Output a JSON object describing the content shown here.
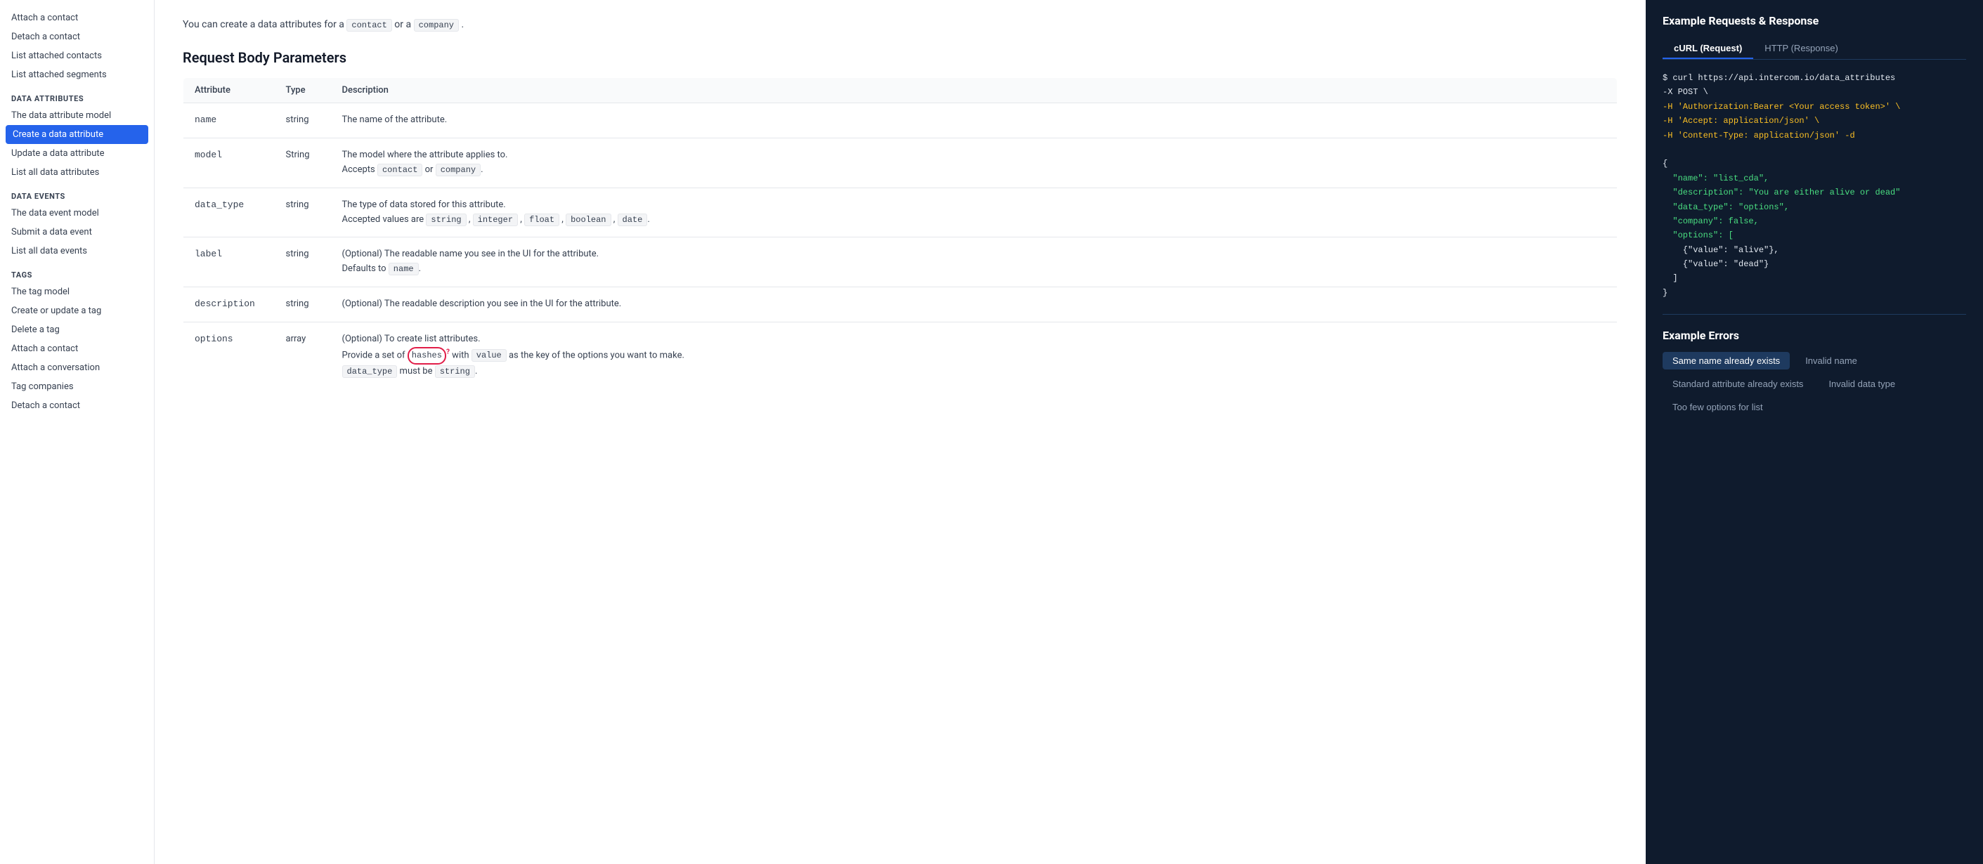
{
  "sidebar": {
    "items_top": [
      {
        "label": "Attach a contact",
        "active": false
      },
      {
        "label": "Detach a contact",
        "active": false
      },
      {
        "label": "List attached contacts",
        "active": false
      },
      {
        "label": "List attached segments",
        "active": false
      }
    ],
    "sections": [
      {
        "header": "DATA ATTRIBUTES",
        "items": [
          {
            "label": "The data attribute model",
            "active": false
          },
          {
            "label": "Create a data attribute",
            "active": true
          },
          {
            "label": "Update a data attribute",
            "active": false
          },
          {
            "label": "List all data attributes",
            "active": false
          }
        ]
      },
      {
        "header": "DATA EVENTS",
        "items": [
          {
            "label": "The data event model",
            "active": false
          },
          {
            "label": "Submit a data event",
            "active": false
          },
          {
            "label": "List all data events",
            "active": false
          }
        ]
      },
      {
        "header": "TAGS",
        "items": [
          {
            "label": "The tag model",
            "active": false
          },
          {
            "label": "Create or update a tag",
            "active": false
          },
          {
            "label": "Delete a tag",
            "active": false
          },
          {
            "label": "Attach a contact",
            "active": false
          },
          {
            "label": "Attach a conversation",
            "active": false
          },
          {
            "label": "Tag companies",
            "active": false
          },
          {
            "label": "Detach a contact",
            "active": false
          }
        ]
      }
    ]
  },
  "main": {
    "intro": "You can create a data attributes for a",
    "intro_code1": "contact",
    "intro_mid": "or a",
    "intro_code2": "company",
    "section_title": "Request Body Parameters",
    "table_headers": [
      "Attribute",
      "Type",
      "Description"
    ],
    "table_rows": [
      {
        "attr": "name",
        "type": "string",
        "desc": "The name of the attribute."
      },
      {
        "attr": "model",
        "type": "String",
        "desc_line1": "The model where the attribute applies to.",
        "desc_line2": "Accepts",
        "desc_code1": "contact",
        "desc_mid": "or",
        "desc_code2": "company",
        "desc_end": "."
      },
      {
        "attr": "data_type",
        "type": "string",
        "desc_line1": "The type of data stored for this attribute.",
        "desc_line2": "Accepted values are",
        "codes": [
          "string",
          "integer",
          "float",
          "boolean",
          "date"
        ],
        "desc_end": "."
      },
      {
        "attr": "label",
        "type": "string",
        "desc_line1": "(Optional) The readable name you see in the UI for the attribute.",
        "desc_line2": "Defaults to",
        "desc_code": "name",
        "desc_end": "."
      },
      {
        "attr": "description",
        "type": "string",
        "desc_line1": "(Optional) The readable description you see in the UI for the attribute."
      },
      {
        "attr": "options",
        "type": "array",
        "desc_line1": "(Optional) To create list attributes.",
        "desc_line2_pre": "Provide a set of",
        "desc_code_circle": "hashes",
        "desc_line2_mid": "with",
        "desc_code_val": "value",
        "desc_line2_post": "as the key of the options you want to make.",
        "desc_line3_pre": "",
        "desc_code_dtype": "data_type",
        "desc_line3_post": "must be",
        "desc_code_string": "string",
        "desc_line3_end": "."
      }
    ]
  },
  "right_panel": {
    "title": "Example Requests & Response",
    "tabs": [
      "cURL (Request)",
      "HTTP (Response)"
    ],
    "active_tab": 0,
    "code_lines": [
      {
        "text": "$ curl https://api.intercom.io/data_attributes",
        "color": "white"
      },
      {
        "text": "-X POST \\",
        "color": "white"
      },
      {
        "text": "-H 'Authorization:Bearer <Your access token>' \\",
        "color": "yellow"
      },
      {
        "text": "-H 'Accept: application/json' \\",
        "color": "yellow"
      },
      {
        "text": "-H 'Content-Type: application/json' -d",
        "color": "yellow"
      },
      {
        "text": "",
        "color": "white"
      },
      {
        "text": "{",
        "color": "white"
      },
      {
        "text": "  \"name\": \"list_cda\",",
        "color": "green"
      },
      {
        "text": "  \"description\": \"You are either alive or dead\"",
        "color": "green"
      },
      {
        "text": "  \"data_type\": \"options\",",
        "color": "green"
      },
      {
        "text": "  \"company\": false,",
        "color": "green"
      },
      {
        "text": "  \"options\": [",
        "color": "green"
      },
      {
        "text": "    {\"value\": \"alive\"},",
        "color": "white"
      },
      {
        "text": "    {\"value\": \"dead\"}",
        "color": "white"
      },
      {
        "text": "  ]",
        "color": "white"
      },
      {
        "text": "}",
        "color": "white"
      }
    ],
    "errors_title": "Example Errors",
    "error_tabs": [
      {
        "label": "Same name already exists",
        "active": true
      },
      {
        "label": "Invalid name",
        "active": false
      },
      {
        "label": "Standard attribute already exists",
        "active": false
      },
      {
        "label": "Invalid data type",
        "active": false
      },
      {
        "label": "Too few options for list",
        "active": false
      }
    ]
  }
}
